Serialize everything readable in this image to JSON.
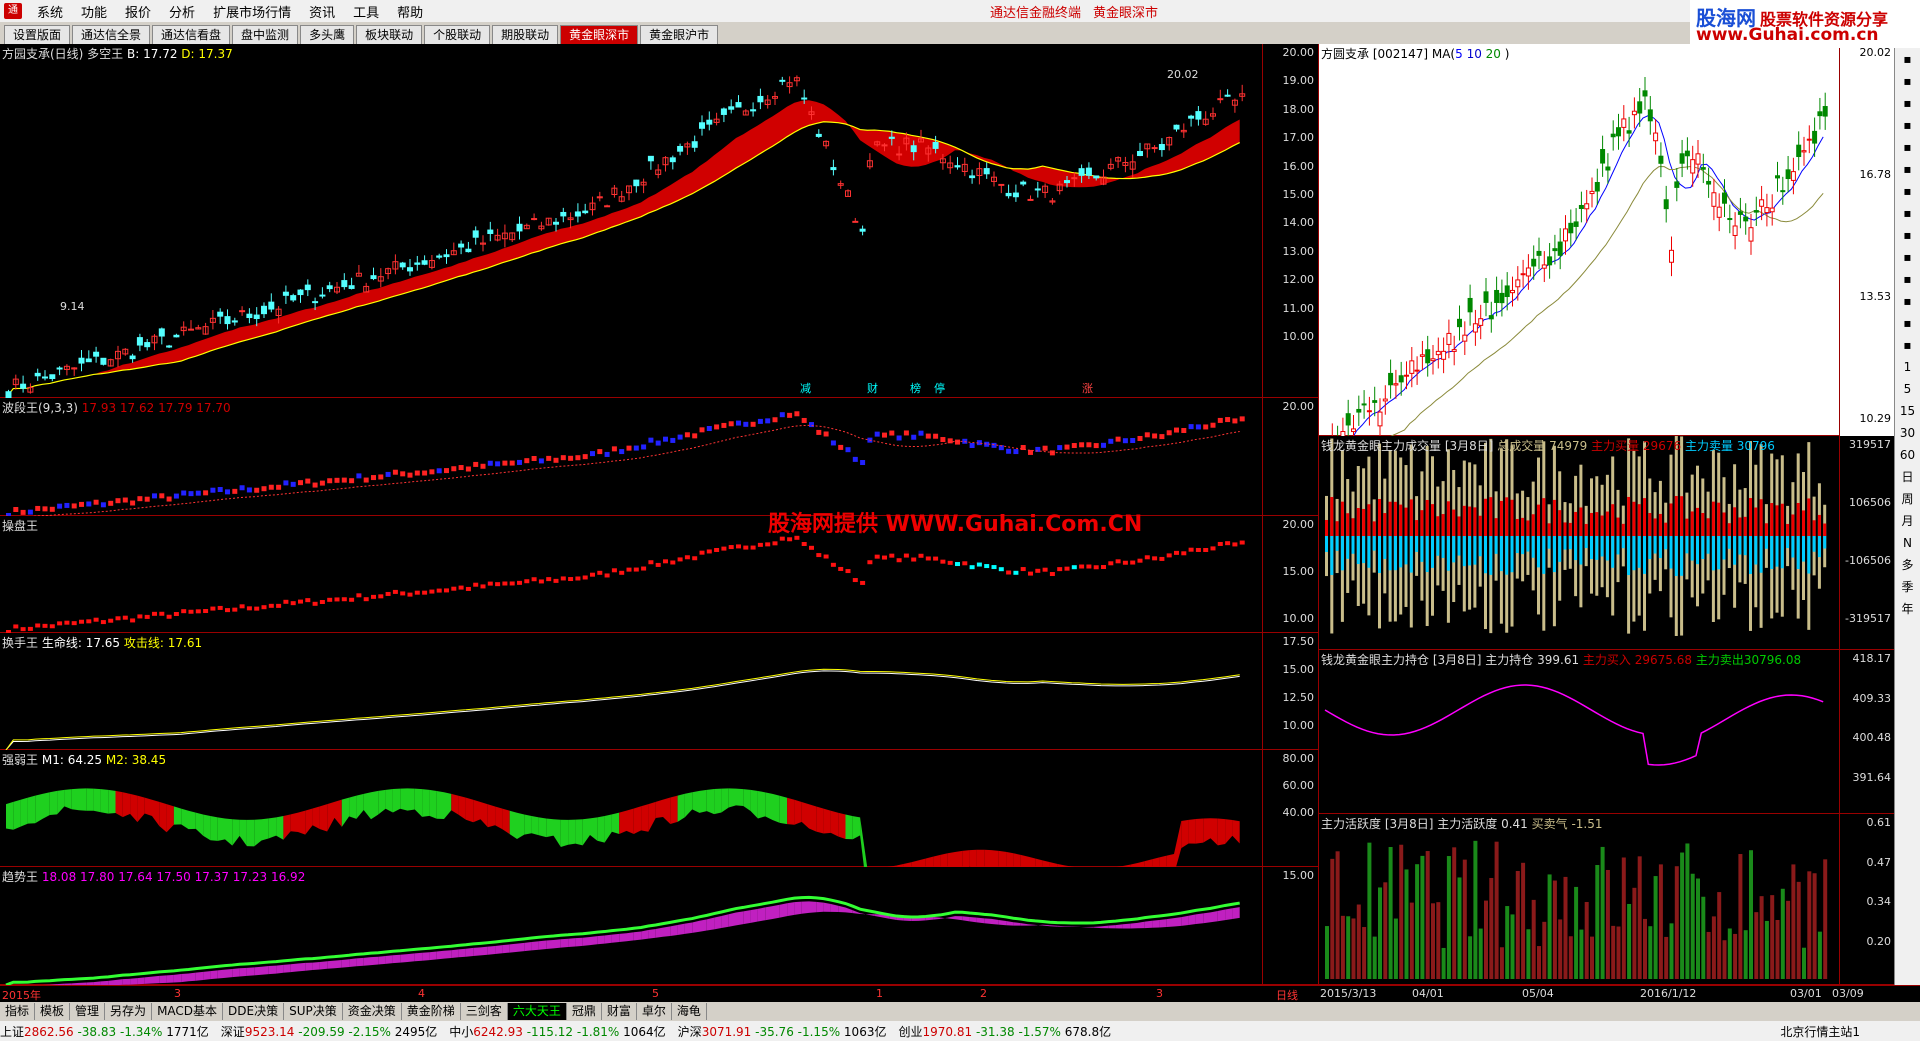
{
  "menu": {
    "items": [
      "系统",
      "功能",
      "报价",
      "分析",
      "扩展市场行情",
      "资讯",
      "工具",
      "帮助"
    ],
    "center_left": "通达信金融终端",
    "center_right": "黄金眼深市"
  },
  "brand": {
    "line1": "股海网",
    "line1b": "股票软件资源分享",
    "line2": "www.Guhai.com.cn"
  },
  "tabs": [
    "设置版面",
    "通达信全景",
    "通达信看盘",
    "盘中监测",
    "多头鹰",
    "板块联动",
    "个股联动",
    "期股联动",
    "黄金眼深市",
    "黄金眼沪市"
  ],
  "active_tab": "黄金眼深市",
  "watermark": "股海网提供 WWW.Guhai.Com.CN",
  "left": {
    "p1": {
      "title": "方园支承(日线) 多空王",
      "b": "B: 17.72",
      "d": "D: 17.37",
      "hi_label": "20.02",
      "lo_label": "9.14",
      "ticks": [
        "20.00",
        "19.00",
        "18.00",
        "17.00",
        "16.00",
        "15.00",
        "14.00",
        "13.00",
        "12.00",
        "11.00",
        "10.00"
      ],
      "markers": [
        "减",
        "财",
        "榜",
        "停",
        "涨"
      ]
    },
    "p2": {
      "title": "波段王(9,3,3)",
      "v": [
        "17.93",
        "17.62",
        "17.79",
        "17.70"
      ],
      "ticks": [
        "20.00"
      ]
    },
    "p3": {
      "title": "操盘王",
      "ticks": [
        "20.00",
        "15.00",
        "10.00"
      ]
    },
    "p4": {
      "title": "换手王",
      "l1": "生命线: 17.65",
      "l2": "攻击线: 17.61",
      "ticks": [
        "17.50",
        "15.00",
        "12.50",
        "10.00"
      ]
    },
    "p5": {
      "title": "强弱王",
      "l1": "M1: 64.25",
      "l2": "M2: 38.45",
      "ticks": [
        "80.00",
        "60.00",
        "40.00"
      ]
    },
    "p6": {
      "title": "趋势王",
      "v": [
        "18.08",
        "17.80",
        "17.64",
        "17.50",
        "17.37",
        "17.23",
        "16.92"
      ],
      "ticks": [
        "15.00"
      ]
    }
  },
  "right": {
    "r1": {
      "title": "方圆支承",
      "code": "[002147]",
      "ma": "MA(",
      "ma1": "5",
      "ma2": "10",
      "ma3": "20",
      ")": ")",
      "ticks": [
        "20.02",
        "16.78",
        "13.53",
        "10.29"
      ]
    },
    "r2": {
      "title": "钱龙黄金眼主力成交量 [3月8日]",
      "a": "总成交量 74979",
      "b": "主力买量 29676",
      "c": "主力卖量 30796",
      "ticks": [
        "319517",
        "106506",
        "-106506",
        "-319517"
      ]
    },
    "r3": {
      "title": "钱龙黄金眼主力持仓 [3月8日]",
      "a": "主力持仓 399.61",
      "b": "主力买入 29675.68",
      "c": "主力卖出30796.08",
      "ticks": [
        "418.17",
        "409.33",
        "400.48",
        "391.64"
      ]
    },
    "r4": {
      "title": "主力活跃度 [3月8日]",
      "a": "主力活跃度 0.41",
      "b": "买卖气 -1.51",
      "ticks": [
        "0.61",
        "0.47",
        "0.34",
        "0.20"
      ]
    }
  },
  "dates_left": [
    "2015年",
    "3",
    "4",
    "5",
    "1",
    "2",
    "3",
    "日线"
  ],
  "dates_right": [
    "2015/3/13",
    "04/01",
    "05/04",
    "2016/1/12",
    "03/01",
    "03/09"
  ],
  "bottom_tabs": [
    "指标",
    "模板",
    "管理",
    "另存为",
    "MACD基本",
    "DDE决策",
    "SUP决策",
    "资金决策",
    "黄金阶梯",
    "三剑客",
    "六大天王",
    "冠鼎",
    "财富",
    "卓尔",
    "海龟"
  ],
  "bottom_selected": "六大天王",
  "status": [
    {
      "name": "上证",
      "v": "2862.56",
      "c": "-38.83",
      "p": "-1.34%",
      "a": "1771亿"
    },
    {
      "name": "深证",
      "v": "9523.14",
      "c": "-209.59",
      "p": "-2.15%",
      "a": "2495亿"
    },
    {
      "name": "中小",
      "v": "6242.93",
      "c": "-115.12",
      "p": "-1.81%",
      "a": "1064亿"
    },
    {
      "name": "沪深",
      "v": "3071.91",
      "c": "-35.76",
      "p": "-1.15%",
      "a": "1063亿"
    },
    {
      "name": "创业",
      "v": "1970.81",
      "c": "-31.38",
      "p": "-1.57%",
      "a": "678.8亿"
    }
  ],
  "status_right": "北京行情主站1",
  "right_tools": [
    "1",
    "5",
    "15",
    "30",
    "60",
    "日",
    "周",
    "月",
    "N",
    "多",
    "季",
    "年"
  ]
}
